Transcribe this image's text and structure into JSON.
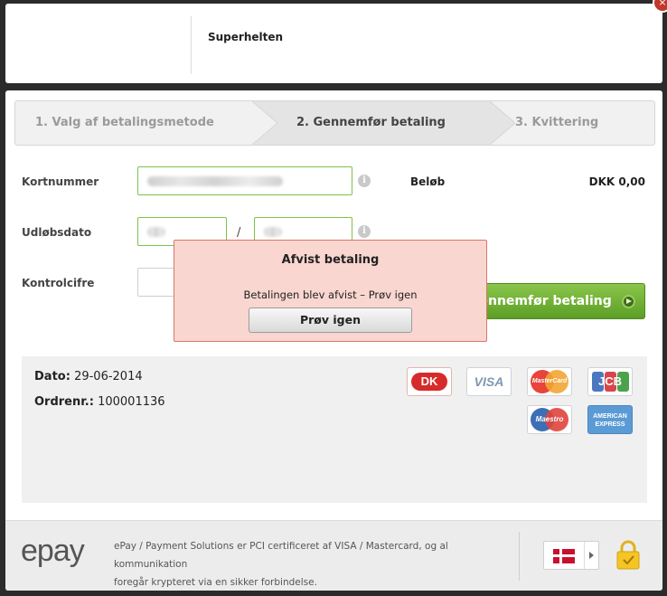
{
  "header": {
    "shop_name": "Superhelten"
  },
  "close": {
    "symbol": "×"
  },
  "steps": [
    {
      "label": "1. Valg af betalingsmetode"
    },
    {
      "label": "2. Gennemfør betaling"
    },
    {
      "label": "3. Kvittering"
    }
  ],
  "form": {
    "card_number_label": "Kortnummer",
    "expiry_label": "Udløbsdato",
    "expiry_separator": "/",
    "cvc_label": "Kontrolcifre",
    "info_symbol": "i"
  },
  "amount": {
    "label": "Beløb",
    "value": "DKK 0,00"
  },
  "pay_button": {
    "label": "Gennemfør betaling"
  },
  "order": {
    "date_label": "Dato:",
    "date_value": "29-06-2014",
    "order_label": "Ordrenr.:",
    "order_value": "100001136"
  },
  "cards": {
    "dk": "DK",
    "visa": "VISA",
    "mastercard": "MasterCard",
    "jcb": "JCB",
    "maestro": "Maestro",
    "amex_1": "AMERICAN",
    "amex_2": "EXPRESS"
  },
  "modal": {
    "title": "Afvist betaling",
    "message": "Betalingen blev afvist – Prøv igen",
    "button": "Prøv igen"
  },
  "footer": {
    "logo": "epay",
    "line1": "ePay / Payment Solutions er PCI certificeret af VISA / Mastercard, og al kommunikation",
    "line2": "foregår krypteret via en sikker forbindelse."
  },
  "colors": {
    "accent_green": "#6db33f",
    "modal_bg": "#f9d6cf",
    "modal_border": "#d9776a"
  }
}
